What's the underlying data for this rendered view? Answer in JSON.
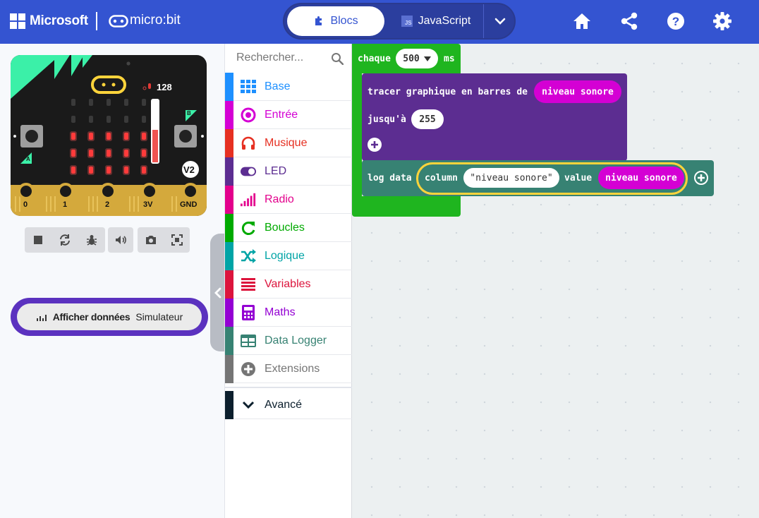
{
  "header": {
    "brand": "Microsoft",
    "product": "micro:bit",
    "tabs": {
      "blocks": "Blocs",
      "javascript": "JavaScript"
    },
    "js_badge": "JS",
    "icons": [
      "home-icon",
      "share-icon",
      "help-icon",
      "settings-icon"
    ],
    "color": "#3454d1"
  },
  "simulator": {
    "sound_level": "128",
    "version_badge": "V2",
    "button_a": "A",
    "button_b": "B",
    "pins": [
      "0",
      "1",
      "2",
      "3V",
      "GND"
    ],
    "controls": [
      "stop-icon",
      "restart-icon",
      "debug-icon",
      "mute-icon",
      "screenshot-icon",
      "fullscreen-icon"
    ],
    "show_data_button": {
      "bold": "Afficher données",
      "normal": "Simulateur"
    }
  },
  "toolbox": {
    "search_placeholder": "Rechercher...",
    "categories": [
      {
        "label": "Base",
        "color": "#1e90ff",
        "icon": "grid-icon"
      },
      {
        "label": "Entrée",
        "color": "#d400d4",
        "icon": "input-icon"
      },
      {
        "label": "Musique",
        "color": "#e63022",
        "icon": "headphones-icon"
      },
      {
        "label": "LED",
        "color": "#5c2d91",
        "icon": "toggle-icon"
      },
      {
        "label": "Radio",
        "color": "#e3008c",
        "icon": "signal-icon"
      },
      {
        "label": "Boucles",
        "color": "#00aa00",
        "icon": "loop-icon"
      },
      {
        "label": "Logique",
        "color": "#00a4a6",
        "icon": "shuffle-icon"
      },
      {
        "label": "Variables",
        "color": "#dc143c",
        "icon": "list-icon"
      },
      {
        "label": "Maths",
        "color": "#9400d3",
        "icon": "calculator-icon"
      },
      {
        "label": "Data Logger",
        "color": "#378273",
        "icon": "table-icon"
      },
      {
        "label": "Extensions",
        "color": "#757575",
        "icon": "plus-icon"
      }
    ],
    "advanced": {
      "label": "Avancé",
      "color": "#0c1f2d",
      "icon": "chevron-down-icon"
    }
  },
  "workspace": {
    "every_block": {
      "keyword": "chaque",
      "interval": "500",
      "unit": "ms"
    },
    "plot_block": {
      "text": "tracer graphique en barres de",
      "value": "niveau sonore",
      "upto": "jusqu'à",
      "upto_value": "255"
    },
    "log_block": {
      "text": "log data",
      "column_kw": "column",
      "column_name": "\"niveau sonore\"",
      "value_kw": "value",
      "value": "niveau sonore"
    }
  }
}
